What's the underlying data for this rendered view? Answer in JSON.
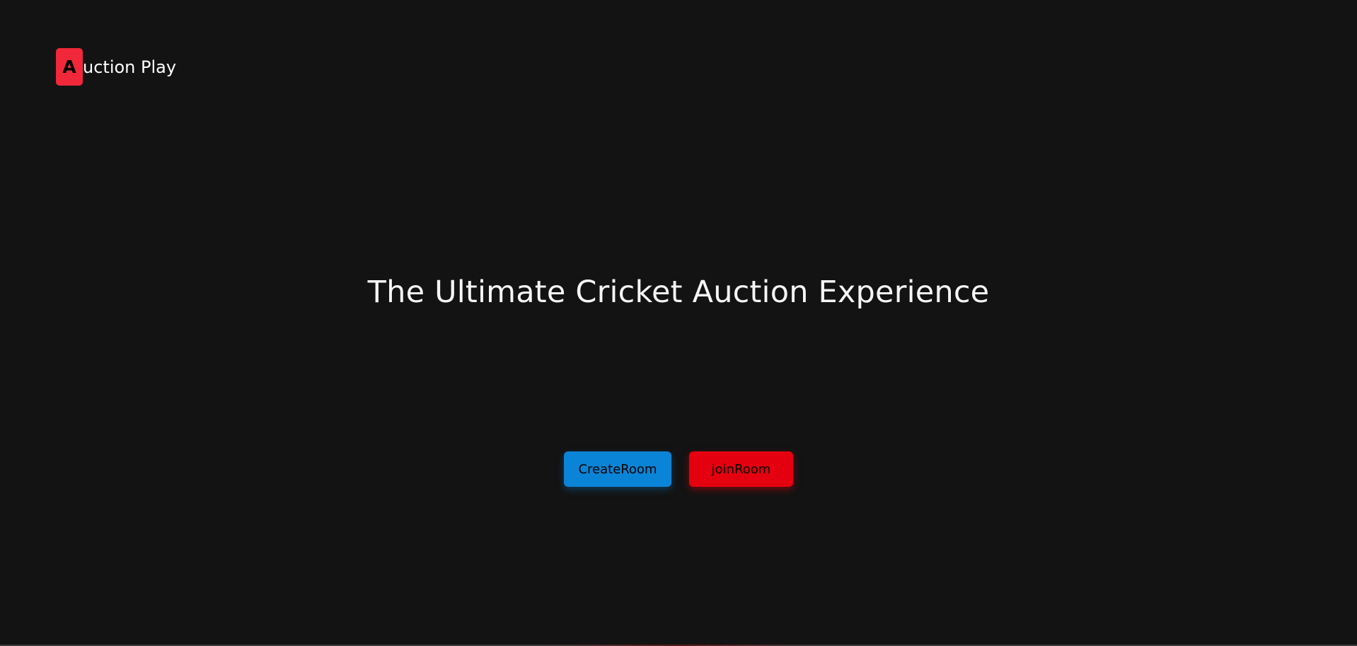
{
  "header": {
    "logo_letter": "A",
    "logo_text": "uction Play"
  },
  "hero": {
    "headline": "The Ultimate Cricket Auction Experience"
  },
  "actions": {
    "create_label": "CreateRoom",
    "join_label": "joinRoom"
  },
  "colors": {
    "background": "#131313",
    "logo_badge": "#f0283a",
    "create_button": "#0a84d6",
    "join_button": "#e5000f"
  }
}
